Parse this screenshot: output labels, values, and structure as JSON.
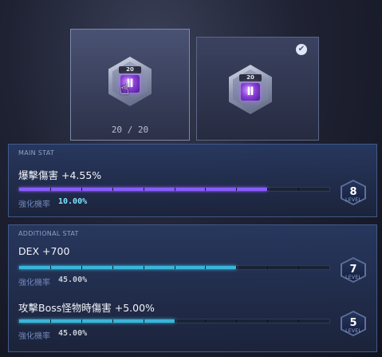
{
  "slots": {
    "left": {
      "badge": "20",
      "glyph": "Ⅱ",
      "count_current": "20",
      "count_sep": "/",
      "count_max": "20"
    },
    "right": {
      "badge": "20",
      "glyph": "Ⅱ",
      "check": "✔"
    }
  },
  "main_stat": {
    "title": "MAIN STAT",
    "name": "爆擊傷害 +4.55%",
    "rate_label": "強化機率",
    "rate_value": "10.00%",
    "level": "8",
    "level_label": "LEVEL",
    "progress": 0.8,
    "bar_color": "#8a5bff"
  },
  "additional_stat": {
    "title": "ADDITIONAL STAT",
    "items": [
      {
        "name": "DEX +700",
        "rate_label": "強化機率",
        "rate_value": "45.00%",
        "level": "7",
        "level_label": "LEVEL",
        "progress": 0.7
      },
      {
        "name": "攻擊Boss怪物時傷害 +5.00%",
        "rate_label": "強化機率",
        "rate_value": "45.00%",
        "level": "5",
        "level_label": "LEVEL",
        "progress": 0.5
      }
    ],
    "bar_color": "#39b6d9"
  },
  "icons": {
    "cursor": "hand-pointer-icon",
    "check": "check-icon",
    "gem": "gem-icon"
  },
  "colors": {
    "main_rate_value": "#7fe3ff",
    "add_rate_value": "#c6ccd8"
  }
}
